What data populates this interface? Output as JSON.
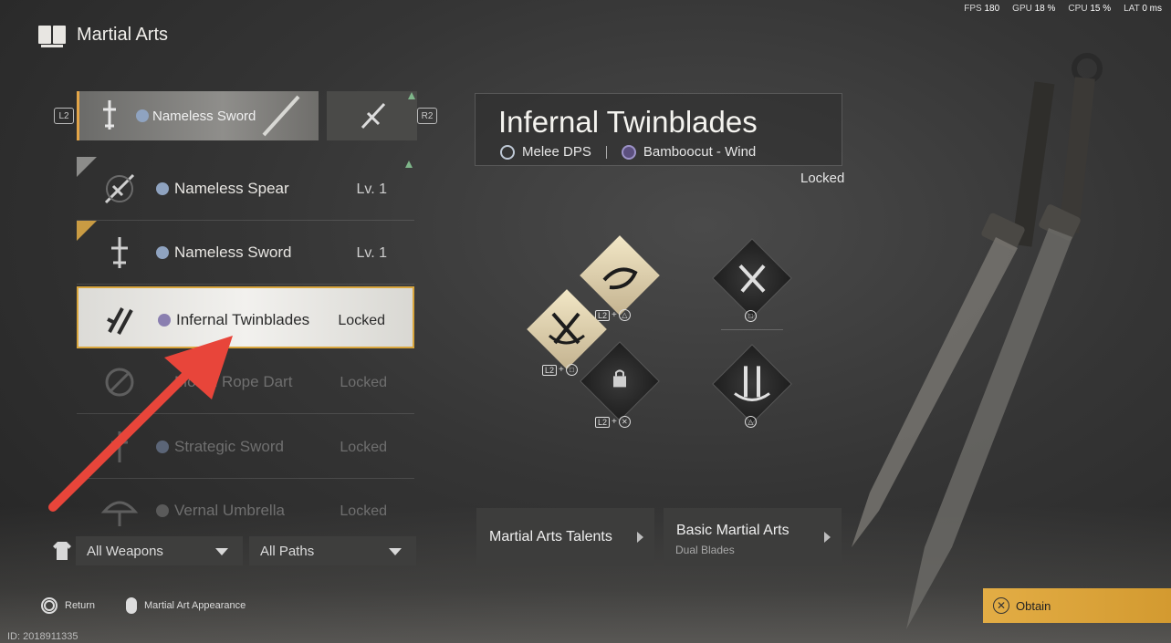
{
  "perf": {
    "fps_label": "FPS",
    "fps": "180",
    "gpu_label": "GPU",
    "gpu": "18 %",
    "cpu_label": "CPU",
    "cpu": "15 %",
    "lat_label": "LAT",
    "lat": "0 ms"
  },
  "header": {
    "title": "Martial Arts",
    "icon": "book-icon"
  },
  "shoulders": {
    "left": "L2",
    "right": "R2"
  },
  "equipped": {
    "name": "Nameless Sword"
  },
  "weapons": [
    {
      "name": "Nameless Spear",
      "status": "Lv. 1",
      "path_icon": "path-icon"
    },
    {
      "name": "Nameless Sword",
      "status": "Lv. 1",
      "path_icon": "path-icon"
    },
    {
      "name": "Infernal Twinblades",
      "status": "Locked",
      "path_icon": "wind-icon"
    },
    {
      "name": "Mortal Rope Dart",
      "status": "Locked"
    },
    {
      "name": "Strategic Sword",
      "status": "Locked"
    },
    {
      "name": "Vernal Umbrella",
      "status": "Locked"
    }
  ],
  "filters": {
    "weapons": "All Weapons",
    "paths": "All Paths"
  },
  "footer": {
    "return_label": "Return",
    "appearance_label": "Martial Art Appearance",
    "user_id": "ID: 2018911335"
  },
  "detail": {
    "title": "Infernal Twinblades",
    "role": "Melee DPS",
    "path": "Bamboocut - Wind",
    "status": "Locked"
  },
  "skills": {
    "combo_l2": "L2",
    "plus": "+",
    "triangle": "△",
    "square": "□",
    "cross": "✕"
  },
  "buttons": {
    "talents": "Martial Arts Talents",
    "basic": "Basic Martial Arts",
    "basic_sub": "Dual Blades",
    "obtain": "Obtain"
  },
  "colors": {
    "accent": "#e3a548",
    "obtain": "#e3ad45",
    "arrow": "#e8453a"
  }
}
